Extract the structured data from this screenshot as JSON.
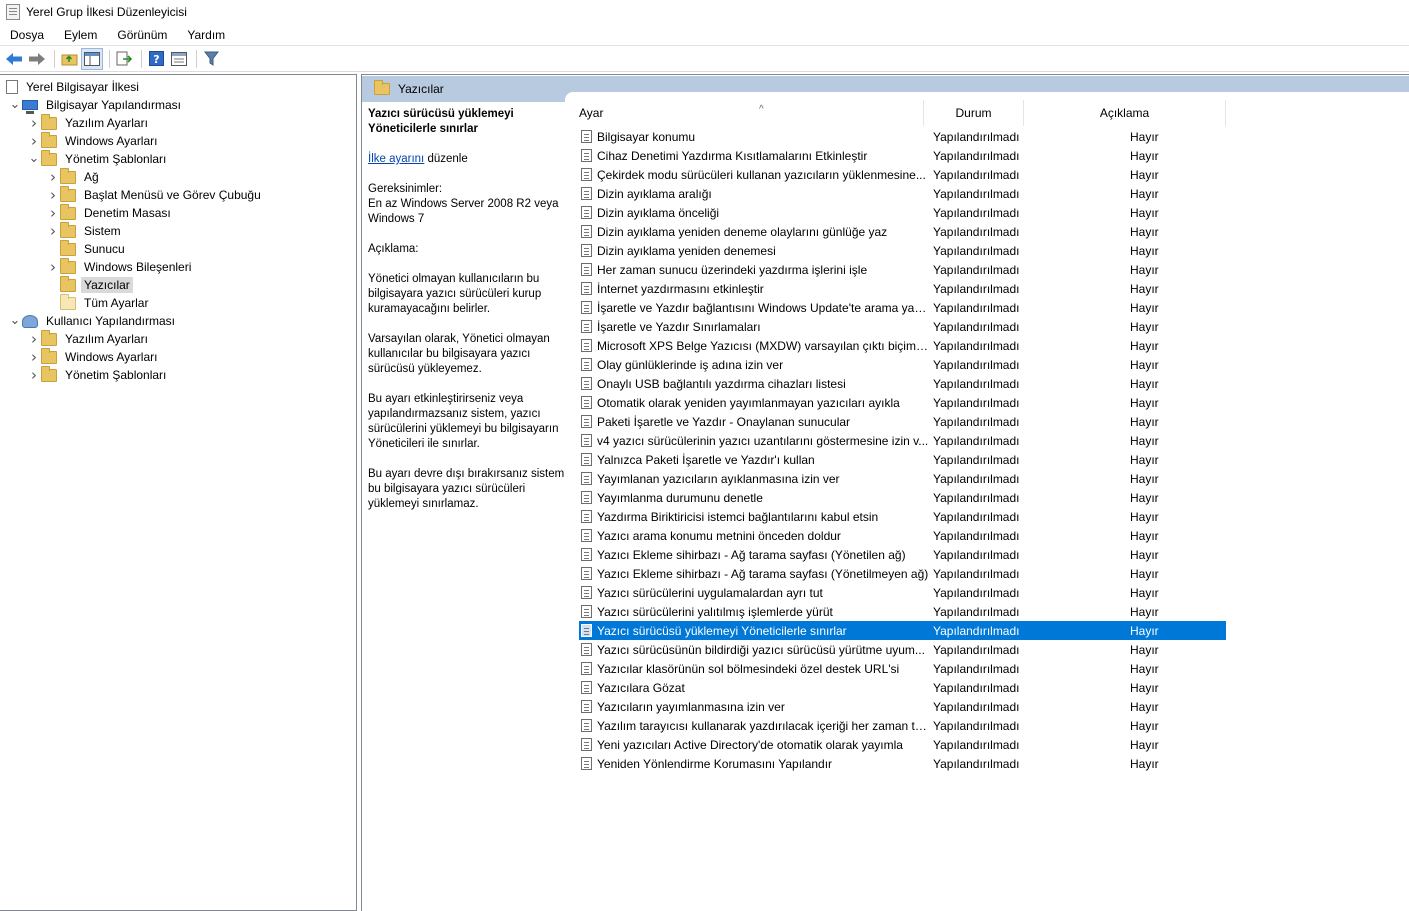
{
  "window": {
    "title": "Yerel Grup İlkesi Düzenleyicisi"
  },
  "menu": [
    "Dosya",
    "Eylem",
    "Görünüm",
    "Yardım"
  ],
  "toolbar": {
    "icons": [
      "back-arrow-icon",
      "forward-arrow-icon",
      "up-folder-icon",
      "show-hide-tree-icon",
      "export-list-icon",
      "help-icon",
      "properties-icon",
      "filter-icon"
    ]
  },
  "tree": [
    {
      "label": "Yerel Bilgisayar İlkesi",
      "depth": 0,
      "expander": "",
      "icon": "policy",
      "selected": false
    },
    {
      "label": "Bilgisayar Yapılandırması",
      "depth": 1,
      "expander": "open",
      "icon": "computer",
      "selected": false
    },
    {
      "label": "Yazılım Ayarları",
      "depth": 2,
      "expander": "closed",
      "icon": "folder",
      "selected": false
    },
    {
      "label": "Windows Ayarları",
      "depth": 2,
      "expander": "closed",
      "icon": "folder",
      "selected": false
    },
    {
      "label": "Yönetim Şablonları",
      "depth": 2,
      "expander": "open",
      "icon": "folder",
      "selected": false
    },
    {
      "label": "Ağ",
      "depth": 3,
      "expander": "closed",
      "icon": "folder",
      "selected": false
    },
    {
      "label": "Başlat Menüsü ve Görev Çubuğu",
      "depth": 3,
      "expander": "closed",
      "icon": "folder",
      "selected": false
    },
    {
      "label": "Denetim Masası",
      "depth": 3,
      "expander": "closed",
      "icon": "folder",
      "selected": false
    },
    {
      "label": "Sistem",
      "depth": 3,
      "expander": "closed",
      "icon": "folder",
      "selected": false
    },
    {
      "label": "Sunucu",
      "depth": 3,
      "expander": "",
      "icon": "folder",
      "selected": false
    },
    {
      "label": "Windows Bileşenleri",
      "depth": 3,
      "expander": "closed",
      "icon": "folder",
      "selected": false
    },
    {
      "label": "Yazıcılar",
      "depth": 3,
      "expander": "",
      "icon": "folder",
      "selected": true
    },
    {
      "label": "Tüm Ayarlar",
      "depth": 3,
      "expander": "",
      "icon": "folder-pale",
      "selected": false
    },
    {
      "label": "Kullanıcı Yapılandırması",
      "depth": 1,
      "expander": "open",
      "icon": "user",
      "selected": false
    },
    {
      "label": "Yazılım Ayarları",
      "depth": 2,
      "expander": "closed",
      "icon": "folder",
      "selected": false
    },
    {
      "label": "Windows Ayarları",
      "depth": 2,
      "expander": "closed",
      "icon": "folder",
      "selected": false
    },
    {
      "label": "Yönetim Şablonları",
      "depth": 2,
      "expander": "closed",
      "icon": "folder",
      "selected": false
    }
  ],
  "header": {
    "title": "Yazıcılar"
  },
  "description": {
    "title": "Yazıcı sürücüsü yüklemeyi Yöneticilerle sınırlar",
    "edit_link": "İlke ayarını",
    "edit_suffix": " düzenle",
    "requirements_label": "Gereksinimler:",
    "requirements": "En az Windows Server 2008 R2 veya Windows 7",
    "description_label": "Açıklama:",
    "paragraph1": "Yönetici olmayan kullanıcıların bu bilgisayara yazıcı sürücüleri kurup kuramayacağını belirler.",
    "paragraph2": "Varsayılan olarak, Yönetici olmayan kullanıcılar bu bilgisayara yazıcı sürücüsü yükleyemez.",
    "paragraph3": "Bu ayarı etkinleştirirseniz veya yapılandırmazsanız sistem, yazıcı sürücülerini yüklemeyi bu bilgisayarın Yöneticileri ile sınırlar.",
    "paragraph4": "Bu ayarı devre dışı bırakırsanız sistem, bu bilgisayara yazıcı sürücüleri yüklemeyi sınırlamaz."
  },
  "columns": {
    "setting": "Ayar",
    "state": "Durum",
    "comment": "Açıklama"
  },
  "settings": [
    {
      "name": "Bilgisayar konumu",
      "state": "Yapılandırılmadı",
      "comment": "Hayır"
    },
    {
      "name": "Cihaz Denetimi Yazdırma Kısıtlamalarını Etkinleştir",
      "state": "Yapılandırılmadı",
      "comment": "Hayır"
    },
    {
      "name": "Çekirdek modu sürücüleri kullanan yazıcıların yüklenmesine...",
      "state": "Yapılandırılmadı",
      "comment": "Hayır"
    },
    {
      "name": "Dizin ayıklama aralığı",
      "state": "Yapılandırılmadı",
      "comment": "Hayır"
    },
    {
      "name": "Dizin ayıklama önceliği",
      "state": "Yapılandırılmadı",
      "comment": "Hayır"
    },
    {
      "name": "Dizin ayıklama yeniden deneme olaylarını günlüğe yaz",
      "state": "Yapılandırılmadı",
      "comment": "Hayır"
    },
    {
      "name": "Dizin ayıklama yeniden denemesi",
      "state": "Yapılandırılmadı",
      "comment": "Hayır"
    },
    {
      "name": "Her zaman sunucu üzerindeki yazdırma işlerini işle",
      "state": "Yapılandırılmadı",
      "comment": "Hayır"
    },
    {
      "name": "İnternet yazdırmasını etkinleştir",
      "state": "Yapılandırılmadı",
      "comment": "Hayır"
    },
    {
      "name": "İşaretle ve Yazdır bağlantısını Windows Update'te arama yap...",
      "state": "Yapılandırılmadı",
      "comment": "Hayır"
    },
    {
      "name": "İşaretle ve Yazdır Sınırlamaları",
      "state": "Yapılandırılmadı",
      "comment": "Hayır"
    },
    {
      "name": "Microsoft XPS Belge Yazıcısı (MXDW) varsayılan çıktı biçimin...",
      "state": "Yapılandırılmadı",
      "comment": "Hayır"
    },
    {
      "name": "Olay günlüklerinde iş adına izin ver",
      "state": "Yapılandırılmadı",
      "comment": "Hayır"
    },
    {
      "name": "Onaylı USB bağlantılı yazdırma cihazları listesi",
      "state": "Yapılandırılmadı",
      "comment": "Hayır"
    },
    {
      "name": "Otomatik olarak yeniden yayımlanmayan yazıcıları ayıkla",
      "state": "Yapılandırılmadı",
      "comment": "Hayır"
    },
    {
      "name": "Paketi İşaretle ve Yazdır - Onaylanan sunucular",
      "state": "Yapılandırılmadı",
      "comment": "Hayır"
    },
    {
      "name": "v4 yazıcı sürücülerinin yazıcı uzantılarını göstermesine izin v...",
      "state": "Yapılandırılmadı",
      "comment": "Hayır"
    },
    {
      "name": "Yalnızca Paketi İşaretle ve Yazdır'ı kullan",
      "state": "Yapılandırılmadı",
      "comment": "Hayır"
    },
    {
      "name": "Yayımlanan yazıcıların ayıklanmasına izin ver",
      "state": "Yapılandırılmadı",
      "comment": "Hayır"
    },
    {
      "name": "Yayımlanma durumunu denetle",
      "state": "Yapılandırılmadı",
      "comment": "Hayır"
    },
    {
      "name": "Yazdırma Biriktiricisi istemci bağlantılarını kabul etsin",
      "state": "Yapılandırılmadı",
      "comment": "Hayır"
    },
    {
      "name": "Yazıcı arama konumu metnini önceden doldur",
      "state": "Yapılandırılmadı",
      "comment": "Hayır"
    },
    {
      "name": "Yazıcı Ekleme sihirbazı - Ağ tarama sayfası (Yönetilen ağ)",
      "state": "Yapılandırılmadı",
      "comment": "Hayır"
    },
    {
      "name": "Yazıcı Ekleme sihirbazı - Ağ tarama sayfası (Yönetilmeyen ağ)",
      "state": "Yapılandırılmadı",
      "comment": "Hayır"
    },
    {
      "name": "Yazıcı sürücülerini uygulamalardan ayrı tut",
      "state": "Yapılandırılmadı",
      "comment": "Hayır"
    },
    {
      "name": "Yazıcı sürücülerini yalıtılmış işlemlerde yürüt",
      "state": "Yapılandırılmadı",
      "comment": "Hayır"
    },
    {
      "name": "Yazıcı sürücüsü yüklemeyi Yöneticilerle sınırlar",
      "state": "Yapılandırılmadı",
      "comment": "Hayır",
      "selected": true
    },
    {
      "name": "Yazıcı sürücüsünün bildirdiği yazıcı sürücüsü yürütme uyum...",
      "state": "Yapılandırılmadı",
      "comment": "Hayır"
    },
    {
      "name": "Yazıcılar klasörünün sol bölmesindeki özel destek URL'si",
      "state": "Yapılandırılmadı",
      "comment": "Hayır"
    },
    {
      "name": "Yazıcılara Gözat",
      "state": "Yapılandırılmadı",
      "comment": "Hayır"
    },
    {
      "name": "Yazıcıların yayımlanmasına izin ver",
      "state": "Yapılandırılmadı",
      "comment": "Hayır"
    },
    {
      "name": "Yazılım tarayıcısı kullanarak yazdırılacak içeriği her zaman tara",
      "state": "Yapılandırılmadı",
      "comment": "Hayır"
    },
    {
      "name": "Yeni yazıcıları Active Directory'de otomatik olarak yayımla",
      "state": "Yapılandırılmadı",
      "comment": "Hayır"
    },
    {
      "name": "Yeniden Yönlendirme Korumasını Yapılandır",
      "state": "Yapılandırılmadı",
      "comment": "Hayır"
    }
  ]
}
